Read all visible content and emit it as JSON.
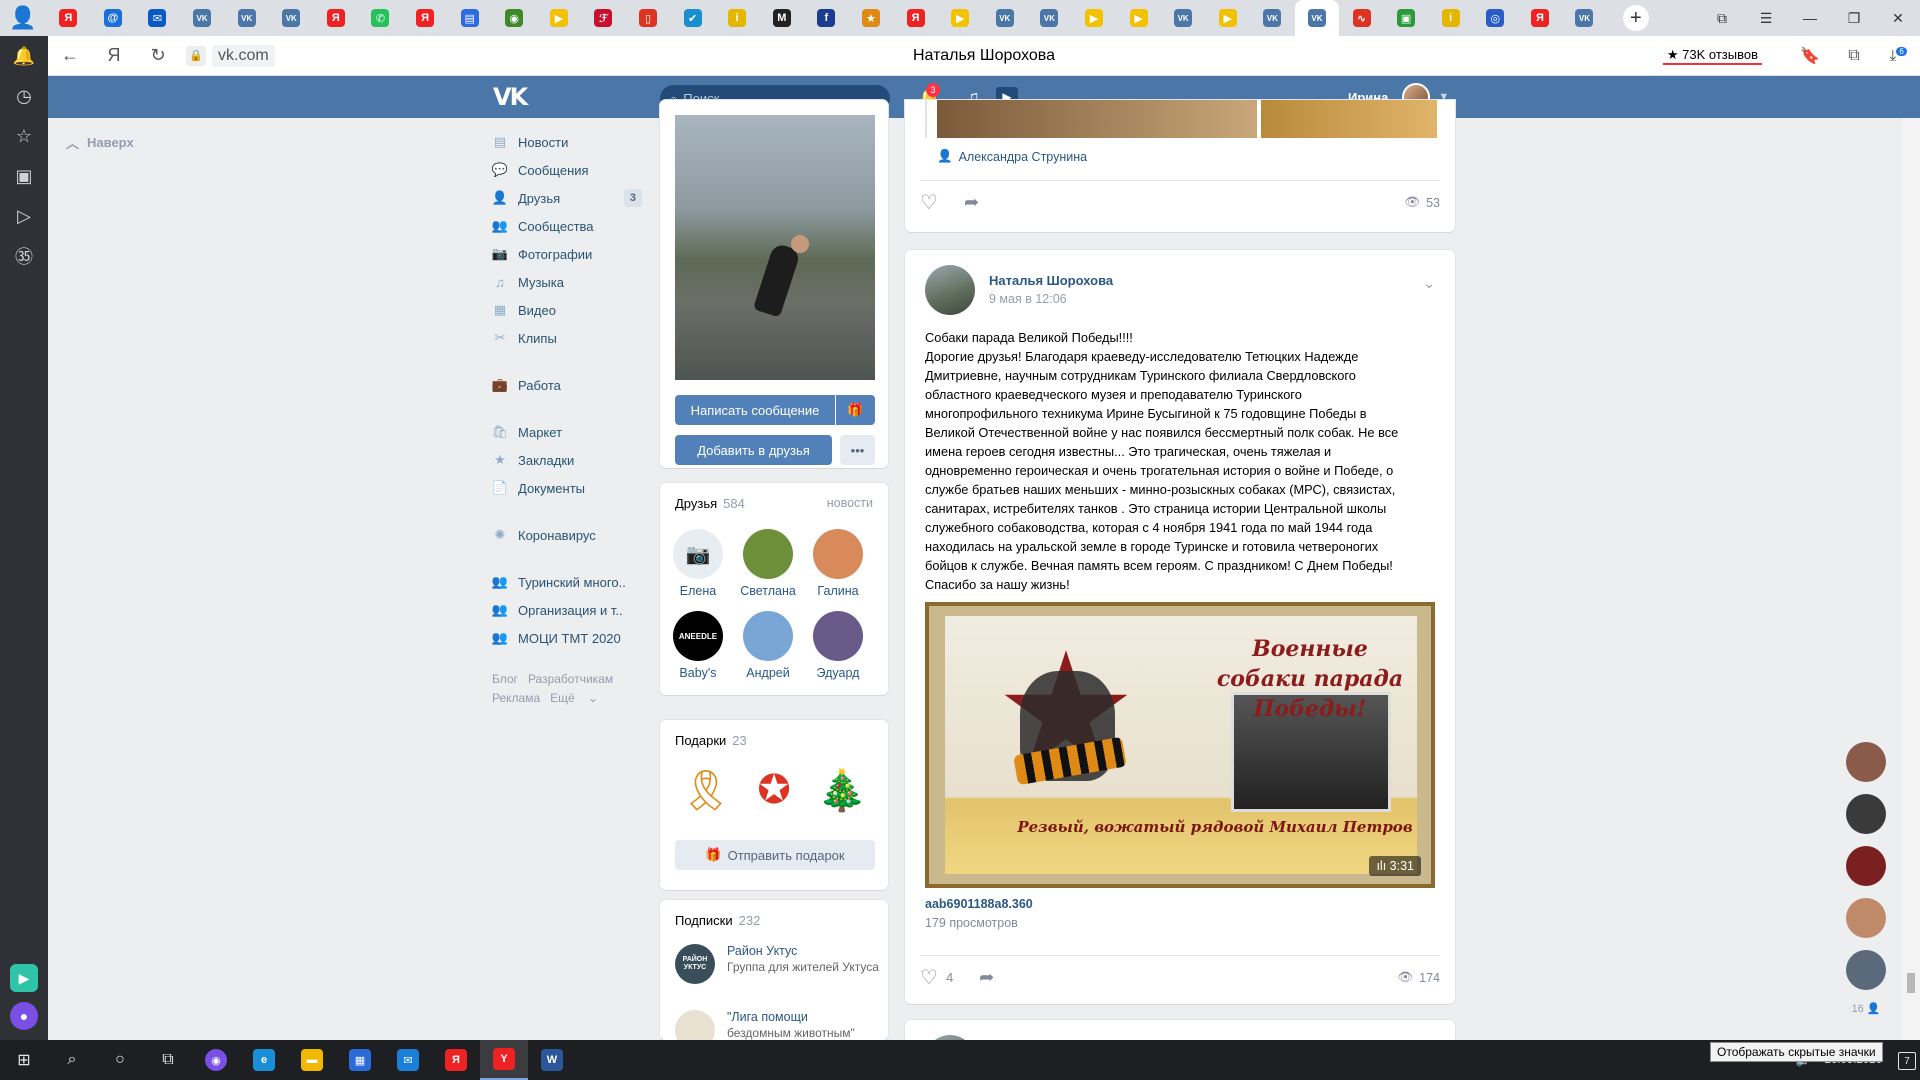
{
  "browser": {
    "tabs": [
      {
        "icon": "yandex-icon",
        "color": "#e22",
        "glyph": "Я"
      },
      {
        "icon": "mail-icon",
        "color": "#1a6fd8",
        "glyph": "@"
      },
      {
        "icon": "outlook-icon",
        "color": "#0b59c4",
        "glyph": "✉"
      },
      {
        "icon": "vk-icon",
        "color": "#4a76a8",
        "glyph": "VK"
      },
      {
        "icon": "vk-icon",
        "color": "#4a76a8",
        "glyph": "VK"
      },
      {
        "icon": "vk-icon",
        "color": "#4a76a8",
        "glyph": "VK"
      },
      {
        "icon": "yandex-icon",
        "color": "#e22",
        "glyph": "Я"
      },
      {
        "icon": "whatsapp-icon",
        "color": "#25c15b",
        "glyph": "✆"
      },
      {
        "icon": "yandex-icon",
        "color": "#e22",
        "glyph": "Я"
      },
      {
        "icon": "docs-icon",
        "color": "#2c6be0",
        "glyph": "▤"
      },
      {
        "icon": "eye-icon",
        "color": "#3d8a2a",
        "glyph": "◉"
      },
      {
        "icon": "play-icon",
        "color": "#f2c200",
        "glyph": "▶"
      },
      {
        "icon": "app-icon",
        "color": "#c8102e",
        "glyph": "ℱ"
      },
      {
        "icon": "pdf-icon",
        "color": "#d32",
        "glyph": "▯"
      },
      {
        "icon": "check-icon",
        "color": "#1a8fd0",
        "glyph": "✔"
      },
      {
        "icon": "info-icon",
        "color": "#e3b600",
        "glyph": "i"
      },
      {
        "icon": "text-icon",
        "color": "#222",
        "glyph": "M"
      },
      {
        "icon": "fb-icon",
        "color": "#1a3d8f",
        "glyph": "f"
      },
      {
        "icon": "badge-icon",
        "color": "#e08a16",
        "glyph": "★"
      },
      {
        "icon": "yandex-icon",
        "color": "#e22",
        "glyph": "Я"
      },
      {
        "icon": "play-icon",
        "color": "#f2c200",
        "glyph": "▶"
      },
      {
        "icon": "vk-icon",
        "color": "#4a76a8",
        "glyph": "VK"
      },
      {
        "icon": "vk-icon",
        "color": "#4a76a8",
        "glyph": "VK"
      },
      {
        "icon": "play-icon",
        "color": "#f2c200",
        "glyph": "▶"
      },
      {
        "icon": "play-icon",
        "color": "#f2c200",
        "glyph": "▶"
      },
      {
        "icon": "vk-icon",
        "color": "#4a76a8",
        "glyph": "VK"
      },
      {
        "icon": "play-icon",
        "color": "#f2c200",
        "glyph": "▶"
      },
      {
        "icon": "vk-icon",
        "color": "#4a76a8",
        "glyph": "VK"
      },
      {
        "icon": "vk-icon",
        "color": "#4a76a8",
        "glyph": "VK",
        "active": true
      },
      {
        "icon": "chart-icon",
        "color": "#d32",
        "glyph": "∿"
      },
      {
        "icon": "gift-icon",
        "color": "#2a9a3a",
        "glyph": "▣"
      },
      {
        "icon": "info-icon",
        "color": "#e3b600",
        "glyph": "i"
      },
      {
        "icon": "globe-icon",
        "color": "#2a5cc8",
        "glyph": "◎"
      },
      {
        "icon": "yandex-icon",
        "color": "#e22",
        "glyph": "Я"
      },
      {
        "icon": "vk-icon",
        "color": "#4a76a8",
        "glyph": "VK"
      }
    ],
    "url": "vk.com",
    "page_title": "Наталья Шорохова",
    "reviews": "73K отзывов",
    "download_badge": "6"
  },
  "vk": {
    "search_placeholder": "Поиск",
    "notifications_count": "3",
    "user_name": "Ирина",
    "to_top": "Наверх",
    "menu": [
      {
        "label": "Новости",
        "icon": "news-icon",
        "glyph": "▤"
      },
      {
        "label": "Сообщения",
        "icon": "messages-icon",
        "glyph": "💬"
      },
      {
        "label": "Друзья",
        "icon": "friends-icon",
        "glyph": "👤",
        "count": "3"
      },
      {
        "label": "Сообщества",
        "icon": "communities-icon",
        "glyph": "👥"
      },
      {
        "label": "Фотографии",
        "icon": "photos-icon",
        "glyph": "📷"
      },
      {
        "label": "Музыка",
        "icon": "music-icon",
        "glyph": "♫"
      },
      {
        "label": "Видео",
        "icon": "video-icon",
        "glyph": "▦"
      },
      {
        "label": "Клипы",
        "icon": "clips-icon",
        "glyph": "✂"
      }
    ],
    "menu2": [
      {
        "label": "Работа",
        "icon": "work-icon",
        "glyph": "💼"
      }
    ],
    "menu3": [
      {
        "label": "Маркет",
        "icon": "market-icon",
        "glyph": "🛍"
      },
      {
        "label": "Закладки",
        "icon": "bookmarks-icon",
        "glyph": "★"
      },
      {
        "label": "Документы",
        "icon": "documents-icon",
        "glyph": "📄"
      }
    ],
    "menu4": [
      {
        "label": "Коронавирус",
        "icon": "coronavirus-icon",
        "glyph": "✺"
      }
    ],
    "menu5": [
      {
        "label": "Туринский много..",
        "icon": "group-icon",
        "glyph": "👥"
      },
      {
        "label": "Организация и т..",
        "icon": "group-icon",
        "glyph": "👥"
      },
      {
        "label": "МОЦИ ТМТ 2020",
        "icon": "group-icon",
        "glyph": "👥"
      }
    ],
    "footer": {
      "blog": "Блог",
      "developers": "Разработчикам",
      "ads": "Реклама",
      "more": "Ещё"
    }
  },
  "profile": {
    "write_message": "Написать сообщение",
    "add_friend": "Добавить в друзья",
    "friends_title": "Друзья",
    "friends_count": "584",
    "friends_updates": "новости",
    "friends": [
      {
        "name": "Елена",
        "color": "#e8edf2"
      },
      {
        "name": "Светлана",
        "color": "#6e8f3a"
      },
      {
        "name": "Галина",
        "color": "#d88a5a"
      },
      {
        "name": "Baby's",
        "color": "#000",
        "label": "ANEEDLE"
      },
      {
        "name": "Андрей",
        "color": "#7aa6d6"
      },
      {
        "name": "Эдуард",
        "color": "#6a5a8a"
      }
    ],
    "gifts_title": "Подарки",
    "gifts_count": "23",
    "send_gift": "Отправить подарок",
    "subs_title": "Подписки",
    "subs_count": "232",
    "subs": [
      {
        "name": "Район Уктус",
        "desc": "Группа для жителей Уктуса",
        "color": "#3a4e5a",
        "label": "РАЙОН УКТУС"
      },
      {
        "name": "\"Лига помощи",
        "desc": "бездомным животным\"",
        "color": "#e8e0d0"
      }
    ]
  },
  "feed": {
    "post1": {
      "tagged": "Александра Струнина",
      "views": "53"
    },
    "post2": {
      "author": "Наталья Шорохова",
      "date": "9 мая в 12:06",
      "text": "Собаки парада Великой Победы!!!!\nДорогие друзья! Благодаря краеведу-исследователю Тетюцких Надежде\nДмитриевне, научным сотрудникам Туринского филиала Свердловского\nобластного краеведческого музея и преподавателю Туринского\nмногопрофильного техникума Ирине Бусыгиной к 75 годовщине Победы в\nВеликой Отечественной войне у нас появился бессмертный полк собак. Не все\nимена героев сегодня известны... Это трагическая, очень тяжелая и\nодновременно героическая и очень трогательная история о войне и Победе, о\nслужбе братьев наших меньших - минно-розыскных собаках (МРС), связистах,\nсанитарах, истребителях танков . Это страница истории Центральной школы\nслужебного собаководства, которая с 4 ноября 1941 года по май 1944 года\nнаходилась на уральской земле в городе Туринске и готовила четвероногих\nбойцов к службе. Вечная память всем героям. С праздником! С Днем Победы!\nСпасибо за нашу жизнь!",
      "video_title_1": "Военные собаки парада Победы!",
      "video_title_2": "Резвый, вожатый рядовой Михаил Петров",
      "video_duration": "3:31",
      "video_name": "aab6901188a8.360",
      "video_views": "179 просмотров",
      "likes": "4",
      "views": "174"
    }
  },
  "chats": {
    "online_count": "16",
    "avatars": [
      "#8a5a4a",
      "#3a3a3a",
      "#7a2020",
      "#c08a6a",
      "#5a6a7a"
    ]
  },
  "taskbar": {
    "apps": [
      {
        "icon": "cortana-icon",
        "color": "#7a4fe5",
        "glyph": "◉"
      },
      {
        "icon": "edge-icon",
        "color": "#1a8fd8",
        "glyph": "e"
      },
      {
        "icon": "explorer-icon",
        "color": "#f2b800",
        "glyph": "▬"
      },
      {
        "icon": "store-icon",
        "color": "#2a6bd8",
        "glyph": "▦"
      },
      {
        "icon": "mail-app-icon",
        "color": "#1a7fd8",
        "glyph": "✉"
      },
      {
        "icon": "yandex-app-icon",
        "color": "#e22",
        "glyph": "Я"
      },
      {
        "icon": "yandex-browser-icon",
        "color": "#e22",
        "glyph": "Y",
        "active": true
      },
      {
        "icon": "word-icon",
        "color": "#2b579a",
        "glyph": "W"
      }
    ],
    "tooltip": "Отображать скрытые значки",
    "date": "26.09.2020",
    "notifications": "7"
  }
}
